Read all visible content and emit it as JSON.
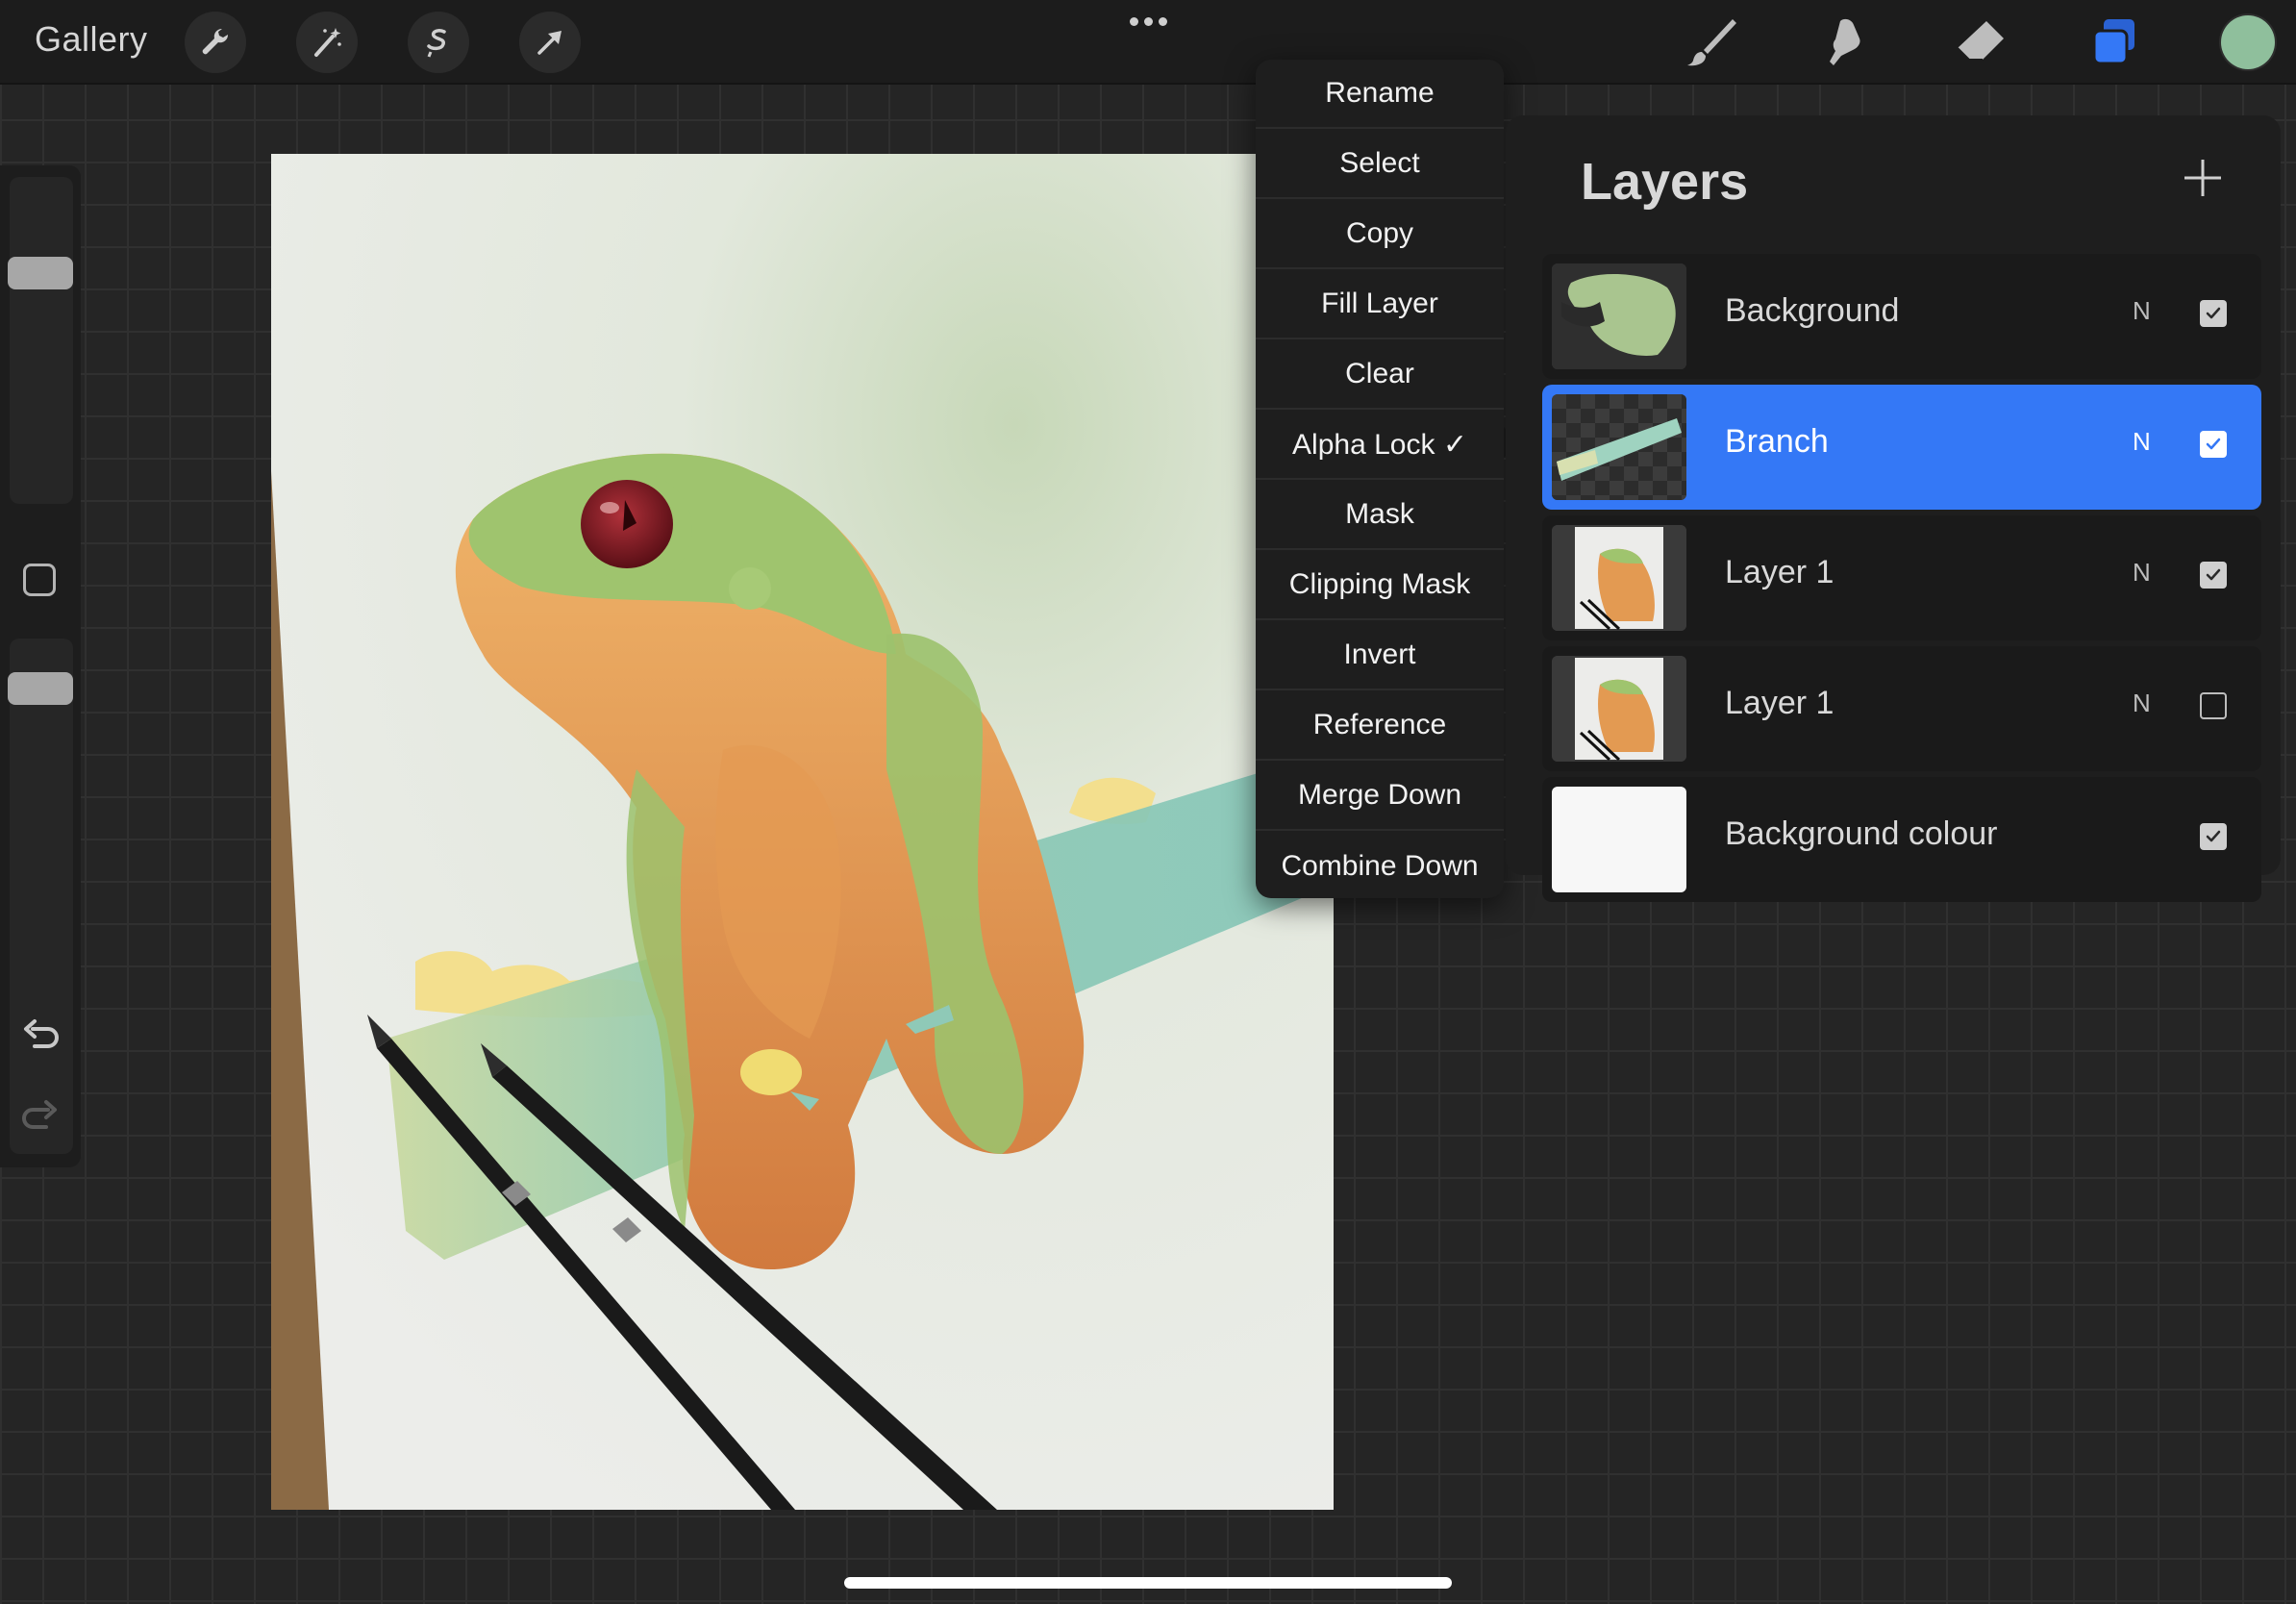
{
  "topbar": {
    "gallery_label": "Gallery",
    "left_tools": [
      {
        "name": "actions-wrench-icon"
      },
      {
        "name": "adjustments-wand-icon"
      },
      {
        "name": "selection-icon"
      },
      {
        "name": "transform-arrow-icon"
      }
    ],
    "right_tools": [
      {
        "name": "brush-icon"
      },
      {
        "name": "smudge-icon"
      },
      {
        "name": "eraser-icon"
      },
      {
        "name": "layers-icon",
        "active": true
      }
    ],
    "current_color": "#8fbf9c",
    "accent_color": "#3478f6"
  },
  "sidebar": {
    "brush_size_level": 0.73,
    "opacity_level": 0.65,
    "undo_icon": "undo-icon",
    "redo_icon": "redo-icon"
  },
  "menu": {
    "items": [
      {
        "label": "Rename"
      },
      {
        "label": "Select"
      },
      {
        "label": "Copy"
      },
      {
        "label": "Fill Layer"
      },
      {
        "label": "Clear"
      },
      {
        "label": "Alpha Lock ✓"
      },
      {
        "label": "Mask"
      },
      {
        "label": "Clipping Mask"
      },
      {
        "label": "Invert"
      },
      {
        "label": "Reference"
      },
      {
        "label": "Merge Down"
      },
      {
        "label": "Combine Down"
      }
    ]
  },
  "layers": {
    "title": "Layers",
    "add_icon": "plus-icon",
    "rows": [
      {
        "name": "Background",
        "blend": "N",
        "visible": true,
        "selected": false
      },
      {
        "name": "Branch",
        "blend": "N",
        "visible": true,
        "selected": true
      },
      {
        "name": "Layer 1",
        "blend": "N",
        "visible": true,
        "selected": false
      },
      {
        "name": "Layer 1",
        "blend": "N",
        "visible": false,
        "selected": false
      },
      {
        "name": "Background colour",
        "blend": "",
        "visible": true,
        "selected": false
      }
    ]
  }
}
